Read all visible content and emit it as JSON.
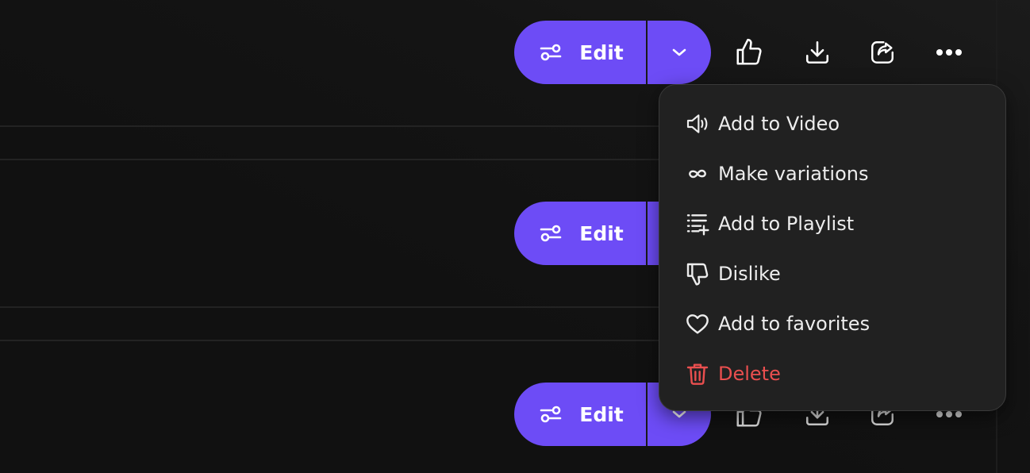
{
  "rows": [
    {
      "edit_label": "Edit"
    },
    {
      "edit_label": "Edit"
    },
    {
      "edit_label": "Edit"
    }
  ],
  "menu": {
    "items": [
      {
        "label": "Add to Video",
        "icon": "speaker-icon"
      },
      {
        "label": "Make variations",
        "icon": "infinity-loop-icon"
      },
      {
        "label": "Add to Playlist",
        "icon": "playlist-add-icon"
      },
      {
        "label": "Dislike",
        "icon": "thumbs-down-icon"
      },
      {
        "label": "Add to favorites",
        "icon": "heart-icon"
      },
      {
        "label": "Delete",
        "icon": "trash-icon"
      }
    ]
  },
  "colors": {
    "accent": "#6d4cf6",
    "background": "#121212",
    "menu_background": "#212121",
    "danger": "#ea4f4f",
    "text": "#ededed"
  }
}
